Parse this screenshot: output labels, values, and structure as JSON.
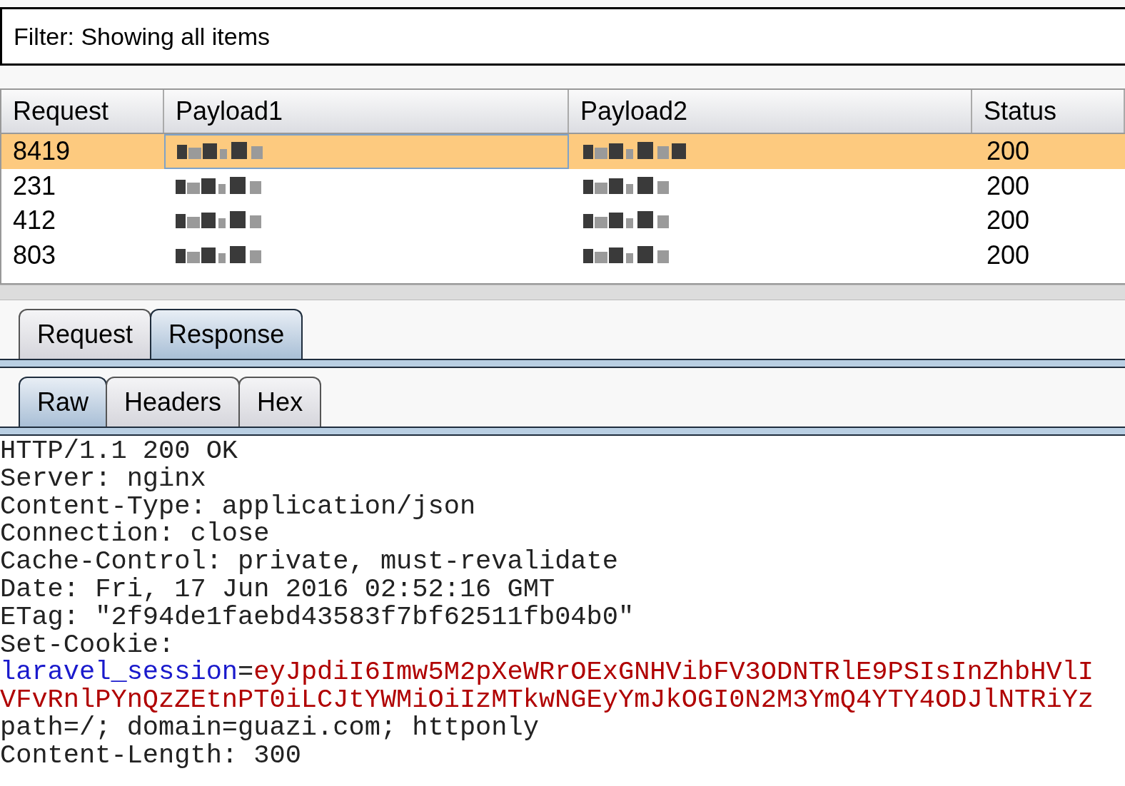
{
  "filter": {
    "label": "Filter: Showing all items"
  },
  "table": {
    "columns": [
      "Request",
      "Payload1",
      "Payload2",
      "Status"
    ],
    "rows": [
      {
        "selected": true,
        "request": "8419",
        "payload1": {
          "kind": "redacted"
        },
        "payload2": {
          "kind": "redacted"
        },
        "status": "200"
      },
      {
        "selected": false,
        "request": "231",
        "payload1": {
          "kind": "redacted"
        },
        "payload2": {
          "kind": "redacted"
        },
        "status": "200"
      },
      {
        "selected": false,
        "request": "412",
        "payload1": {
          "kind": "redacted"
        },
        "payload2": {
          "kind": "redacted"
        },
        "status": "200"
      },
      {
        "selected": false,
        "request": "803",
        "payload1": {
          "kind": "redacted"
        },
        "payload2": {
          "kind": "redacted"
        },
        "status": "200"
      }
    ]
  },
  "message_tabs": [
    {
      "label": "Request",
      "selected": false
    },
    {
      "label": "Response",
      "selected": true
    }
  ],
  "view_tabs": [
    {
      "label": "Raw",
      "selected": true
    },
    {
      "label": "Headers",
      "selected": false
    },
    {
      "label": "Hex",
      "selected": false
    }
  ],
  "raw_response": [
    {
      "kind": "plain",
      "text": "HTTP/1.1 200 OK"
    },
    {
      "kind": "plain",
      "text": "Server: nginx"
    },
    {
      "kind": "plain",
      "text": "Content-Type: application/json"
    },
    {
      "kind": "plain",
      "text": "Connection: close"
    },
    {
      "kind": "plain",
      "text": "Cache-Control: private, must-revalidate"
    },
    {
      "kind": "plain",
      "text": "Date: Fri, 17 Jun 2016 02:52:16 GMT"
    },
    {
      "kind": "plain",
      "text": "ETag: \"2f94de1faebd43583f7bf62511fb04b0\""
    },
    {
      "kind": "plain",
      "text": "Set-Cookie:"
    },
    {
      "kind": "cookie",
      "name": "laravel_session",
      "sep": "=",
      "value": "eyJpdiI6Imw5M2pXeWRrOExGNHVibFV3ODNTRlE9PSIsInZhbHVlI"
    },
    {
      "kind": "value",
      "text": "VFvRnlPYnQzZEtnPT0iLCJtYWMiOiIzMTkwNGEyYmJkOGI0N2M3YmQ4YTY4ODJlNTRiYz"
    },
    {
      "kind": "plain",
      "text": "path=/; domain=guazi.com; httponly"
    },
    {
      "kind": "plain",
      "text": "Content-Length: 300"
    }
  ]
}
